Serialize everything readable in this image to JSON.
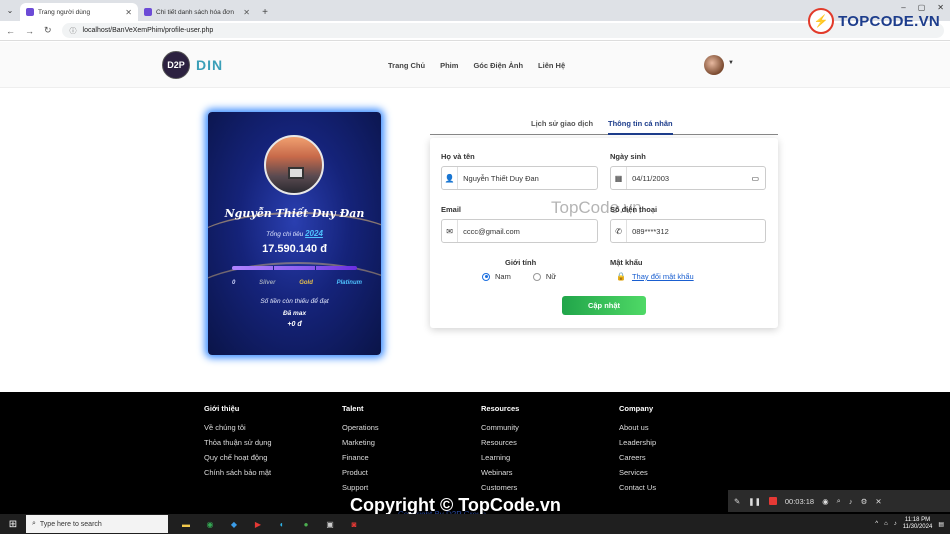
{
  "browser": {
    "tabs": [
      {
        "label": "Trang người dùng",
        "active": true
      },
      {
        "label": "Chi tiết danh sách hóa đơn",
        "active": false
      }
    ],
    "url": "localhost/BanVeXemPhim/profile-user.php"
  },
  "watermark": {
    "brand": "TOPCODE.VN",
    "middle": "TopCode.vn",
    "bottom": "Copyright © TopCode.vn"
  },
  "header": {
    "logo_badge": "D2P",
    "logo_text": "DIN",
    "nav": [
      "Trang Chủ",
      "Phim",
      "Góc Điện Ảnh",
      "Liên Hệ"
    ]
  },
  "card": {
    "name": "Nguyễn Thiết Duy Đan",
    "spend_label": "Tổng chi tiêu",
    "year": "2024",
    "amount": "17.590.140 đ",
    "tiers": [
      "0",
      "Silver",
      "Gold",
      "Platinum"
    ],
    "progress": 1.0,
    "remaining_label": "Số tiền còn thiếu để đạt",
    "status": "Đã max",
    "remaining_amount": "+0 đ"
  },
  "profile_tabs": [
    {
      "label": "Lịch sử giao dịch",
      "active": false
    },
    {
      "label": "Thông tin cá nhân",
      "active": true
    }
  ],
  "form": {
    "fullname_label": "Họ và tên",
    "fullname_value": "Nguyễn Thiết Duy Đan",
    "dob_label": "Ngày sinh",
    "dob_value": "04/11/2003",
    "email_label": "Email",
    "email_value": "cccc@gmail.com",
    "phone_label": "Số điện thoại",
    "phone_value": "089****312",
    "gender_label": "Giới tính",
    "gender_options": [
      "Nam",
      "Nữ"
    ],
    "gender_selected": "Nam",
    "password_label": "Mật khẩu",
    "password_link": "Thay đổi mật khẩu",
    "submit_label": "Cập nhật"
  },
  "footer": {
    "columns": [
      {
        "heading": "Giới thiệu",
        "links": [
          "Về chúng tôi",
          "Thỏa thuận sử dụng",
          "Quy chế hoạt động",
          "Chính sách bảo mật"
        ]
      },
      {
        "heading": "Talent",
        "links": [
          "Operations",
          "Marketing",
          "Finance",
          "Product",
          "Support"
        ]
      },
      {
        "heading": "Resources",
        "links": [
          "Community",
          "Resources",
          "Learning",
          "Webinars",
          "Customers"
        ]
      },
      {
        "heading": "Company",
        "links": [
          "About us",
          "Leadership",
          "Careers",
          "Services",
          "Contact Us"
        ]
      }
    ],
    "copyright": "Copyright By D2P Group"
  },
  "recorder": {
    "time": "00:03:18"
  },
  "taskbar": {
    "search_placeholder": "Type here to search",
    "time": "11:18 PM",
    "date": "11/30/2024"
  }
}
